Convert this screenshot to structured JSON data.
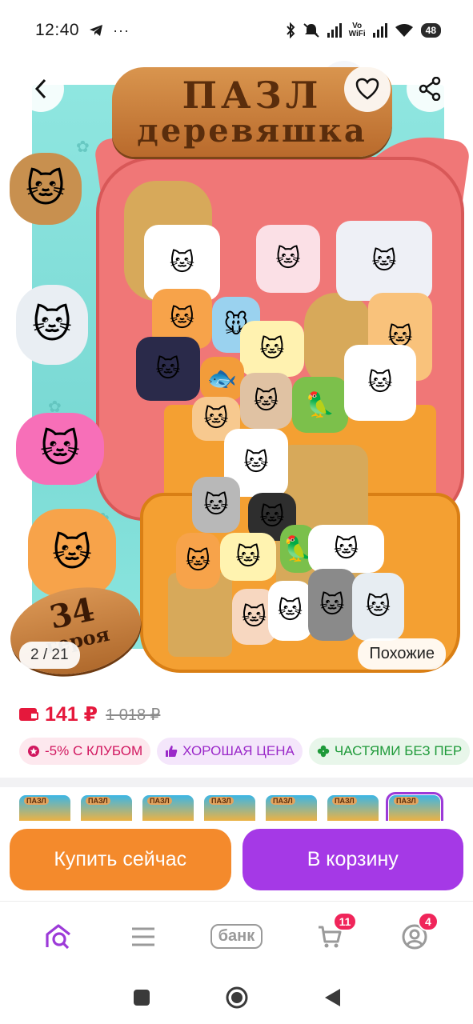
{
  "status_bar": {
    "time": "12:40",
    "left_icons": [
      "telegram-icon",
      "more-dots-icon"
    ],
    "right_icons": [
      "bluetooth-icon",
      "mute-icon",
      "signal-icon",
      "vowifi-icon",
      "signal-icon",
      "wifi-icon"
    ],
    "vowifi_top": "Vo",
    "vowifi_bottom": "WiFi",
    "battery": "48"
  },
  "hero": {
    "logo_line1": "ПАЗЛ",
    "logo_line2": "деревяшка",
    "badge_number": "34",
    "badge_word": "героя",
    "counter": "2 / 21",
    "similar_label": "Похожие"
  },
  "price": {
    "current": "141 ₽",
    "old": "1 018 ₽"
  },
  "promo_chips": [
    {
      "label": "-5% С КЛУБОМ",
      "icon": "club-icon"
    },
    {
      "label": "ХОРОШАЯ ЦЕНА",
      "icon": "thumb-up-icon"
    },
    {
      "label": "ЧАСТЯМИ БЕЗ ПЕР",
      "icon": "clover-icon"
    }
  ],
  "thumbnails": {
    "label": "ПАЗЛ",
    "active_index": 6,
    "count": 7
  },
  "actions": {
    "buy_now": "Купить сейчас",
    "to_cart": "В корзину"
  },
  "bottom_nav": {
    "bank_label": "банк",
    "cart_badge": "11",
    "profile_badge": "4"
  },
  "colors": {
    "price_red": "#e5183c",
    "buy_orange": "#f48a2c",
    "cart_purple": "#a539e6",
    "active_nav": "#9c3ad8",
    "badge_pink": "#f0255a"
  }
}
